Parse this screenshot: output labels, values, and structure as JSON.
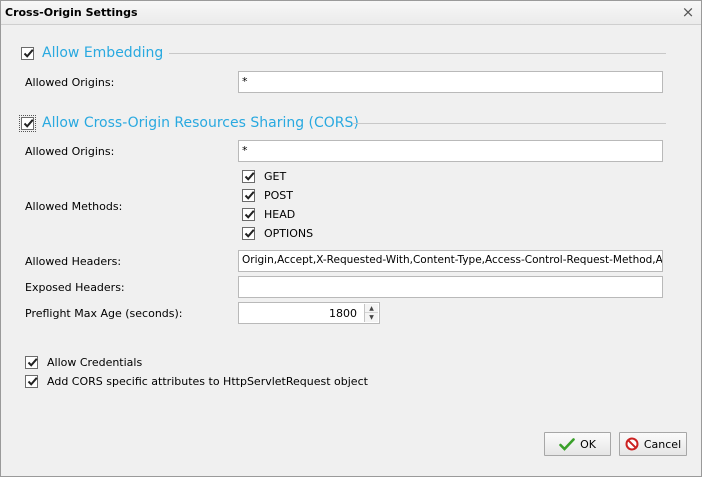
{
  "dialog": {
    "title": "Cross-Origin Settings",
    "close_glyph": "×"
  },
  "embedding": {
    "section_title": "Allow Embedding",
    "checked": true,
    "allowed_origins_label": "Allowed Origins:",
    "allowed_origins_value": "*"
  },
  "cors": {
    "section_title": "Allow Cross-Origin Resources Sharing (CORS)",
    "checked": true,
    "allowed_origins_label": "Allowed Origins:",
    "allowed_origins_value": "*",
    "allowed_methods_label": "Allowed Methods:",
    "methods": [
      {
        "label": "GET",
        "checked": true
      },
      {
        "label": "POST",
        "checked": true
      },
      {
        "label": "HEAD",
        "checked": true
      },
      {
        "label": "OPTIONS",
        "checked": true
      }
    ],
    "allowed_headers_label": "Allowed Headers:",
    "allowed_headers_value": "Origin,Accept,X-Requested-With,Content-Type,Access-Control-Request-Method,Access",
    "exposed_headers_label": "Exposed Headers:",
    "exposed_headers_value": "",
    "preflight_label": "Preflight Max Age (seconds):",
    "preflight_value": "1800",
    "allow_credentials_label": "Allow Credentials",
    "allow_credentials_checked": true,
    "add_attributes_label": "Add CORS specific attributes to HttpServletRequest object",
    "add_attributes_checked": true
  },
  "buttons": {
    "ok_label": "OK",
    "cancel_label": "Cancel"
  },
  "colors": {
    "section_title": "#29a9e0",
    "ok_icon": "#3aa02a",
    "cancel_icon": "#cc2222"
  }
}
